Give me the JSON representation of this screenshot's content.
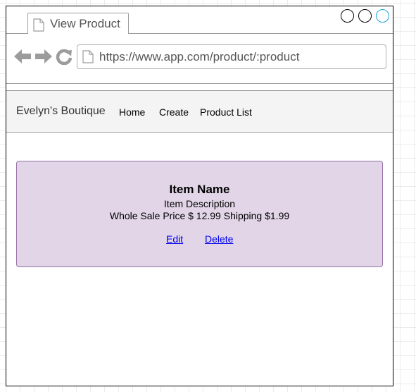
{
  "browser": {
    "tab_title": "View Product",
    "url": "https://www.app.com/product/:product",
    "window_controls": [
      "circle-button",
      "circle-button",
      "circle-button-active"
    ],
    "accent_color": "#1ba1e2"
  },
  "navbar": {
    "brand": "Evelyn's Boutique",
    "links": [
      "Home",
      "Create",
      "Product List"
    ]
  },
  "product": {
    "name": "Item Name",
    "description": "Item Description",
    "price_line": "Whole Sale Price $ 12.99 Shipping $1.99",
    "actions": [
      "Edit",
      "Delete"
    ],
    "card_color": "#e1d5e7",
    "card_border_color": "#9673a6"
  }
}
